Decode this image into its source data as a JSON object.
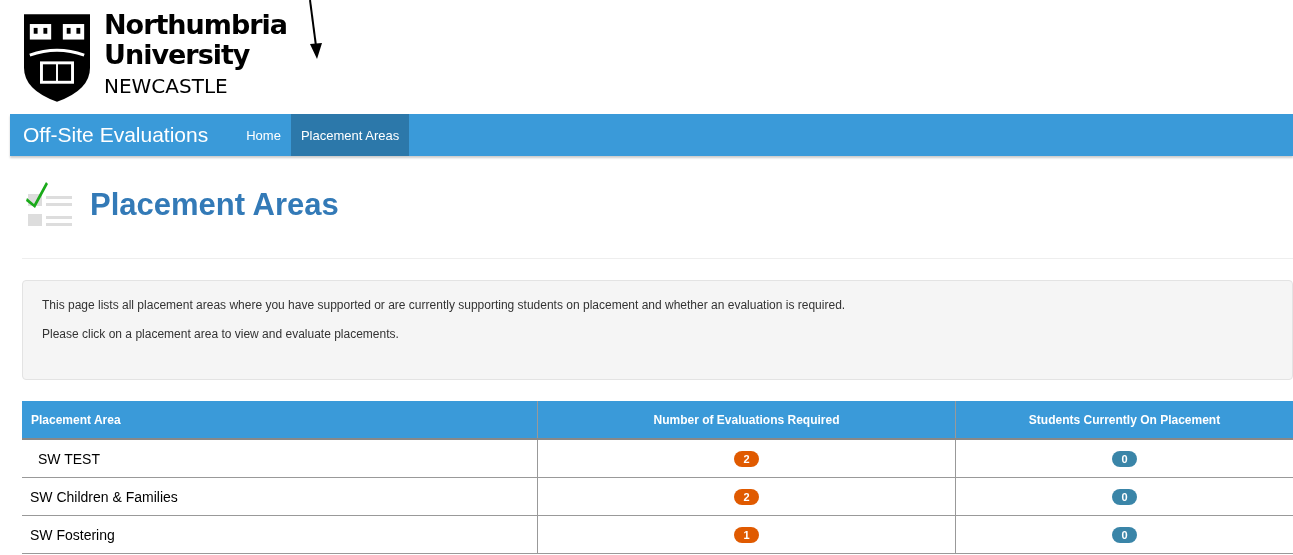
{
  "logo": {
    "lines": [
      "Northumbria",
      "University",
      "NEWCASTLE"
    ]
  },
  "navbar": {
    "brand": "Off-Site Evaluations",
    "items": [
      {
        "label": "Home",
        "selected": false
      },
      {
        "label": "Placement Areas",
        "selected": true
      }
    ]
  },
  "page_title": "Placement Areas",
  "info": [
    "This page lists all placement areas where you have supported or are currently supporting students on placement and whether an evaluation is required.",
    "Please click on a placement area to view and evaluate placements."
  ],
  "table": {
    "columns": [
      "Placement Area",
      "Number of Evaluations Required",
      "Students Currently On Placement"
    ],
    "rows": [
      {
        "area": "SW TEST",
        "evaluations": "2",
        "students": "0"
      },
      {
        "area": "SW Children & Families",
        "evaluations": "2",
        "students": "0"
      },
      {
        "area": "SW Fostering",
        "evaluations": "1",
        "students": "0"
      }
    ]
  }
}
